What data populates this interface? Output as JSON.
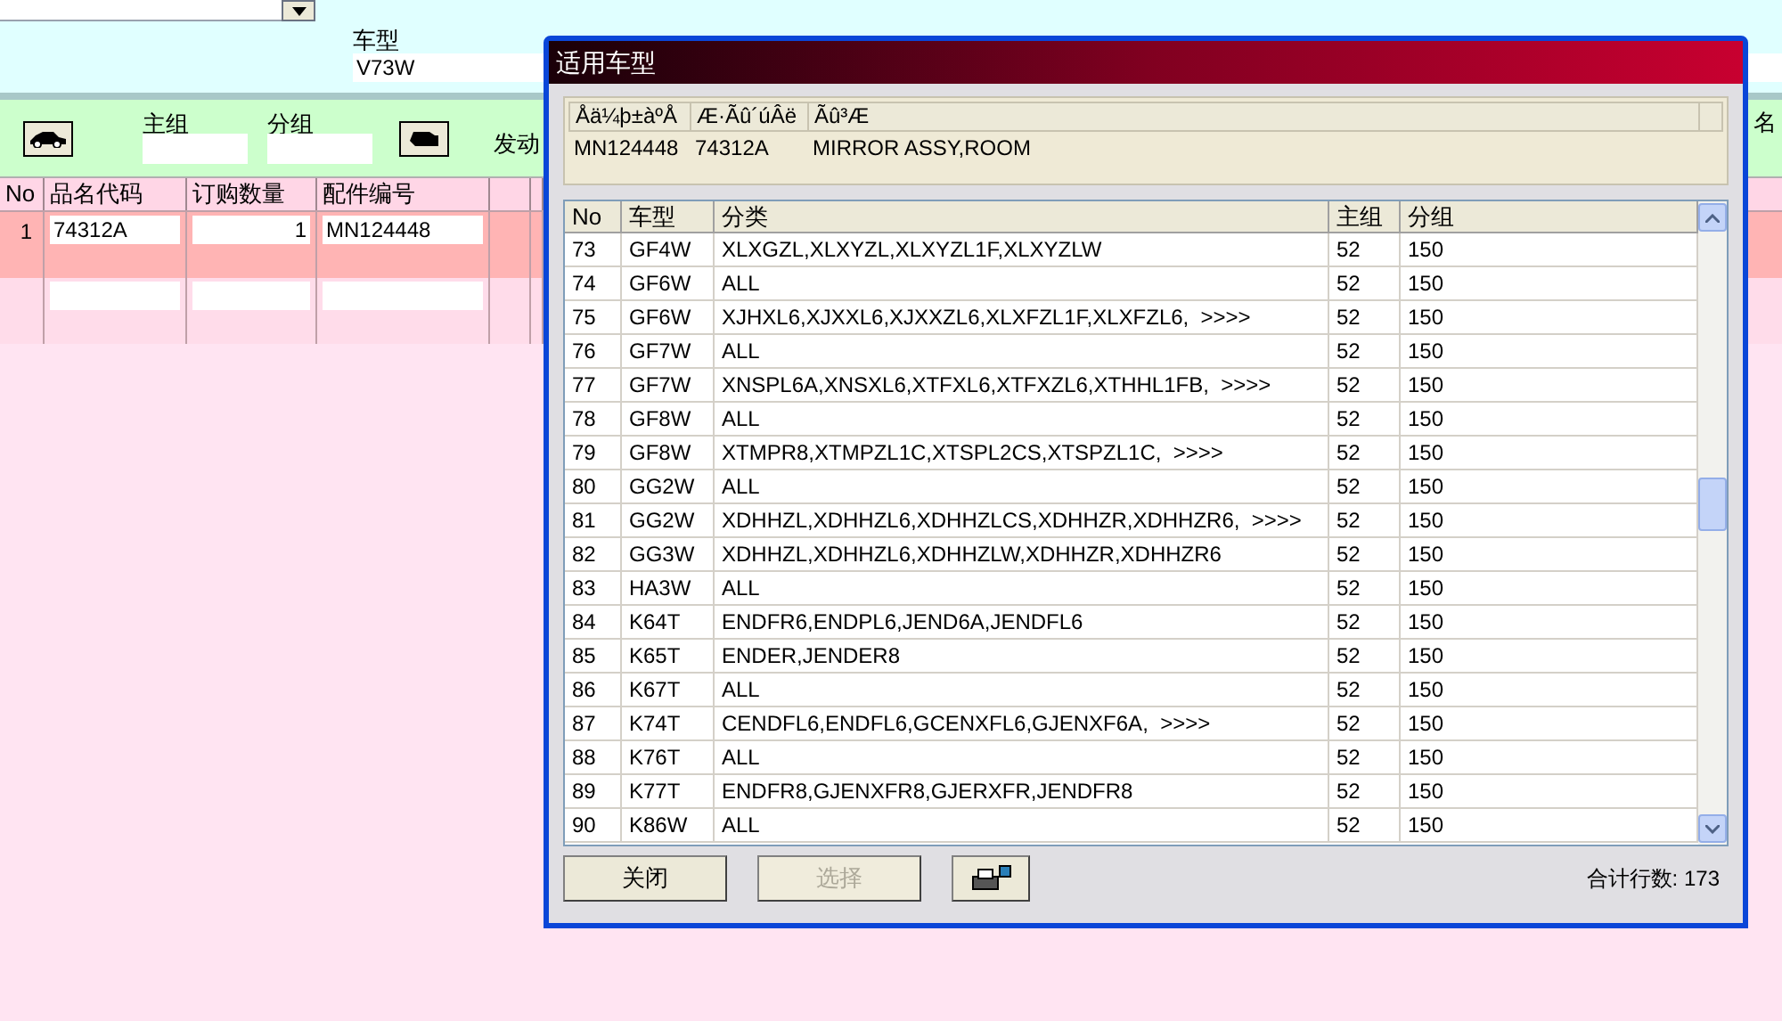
{
  "background": {
    "model_label": "车型",
    "model_value": "V73W",
    "main_group_label": "主组",
    "sub_group_label": "分组",
    "engine_label": "发动",
    "right_edge_label": "名",
    "order_columns": [
      "No",
      "品名代码",
      "订购数量",
      "配件编号"
    ],
    "order_rows": [
      {
        "no": "1",
        "code": "74312A",
        "qty": "1",
        "part": "MN124448",
        "selected": true
      },
      {
        "no": "",
        "code": "",
        "qty": "",
        "part": "",
        "selected": false
      }
    ]
  },
  "dialog": {
    "title": "适用车型",
    "info_columns": [
      "Åä¼þ±àºÅ",
      "Æ·Ãû´úÂë",
      "Ãû³Æ"
    ],
    "info_row": [
      "MN124448",
      "74312A",
      "MIRROR ASSY,ROOM"
    ],
    "columns": [
      "No",
      "车型",
      "分类",
      "主组",
      "分组"
    ],
    "rows": [
      [
        "73",
        "GF4W",
        "XLXGZL,XLXYZL,XLXYZL1F,XLXYZLW",
        "52",
        "150"
      ],
      [
        "74",
        "GF6W",
        "ALL",
        "52",
        "150"
      ],
      [
        "75",
        "GF6W",
        "XJHXL6,XJXXL6,XJXXZL6,XLXFZL1F,XLXFZL6,  >>>>",
        "52",
        "150"
      ],
      [
        "76",
        "GF7W",
        "ALL",
        "52",
        "150"
      ],
      [
        "77",
        "GF7W",
        "XNSPL6A,XNSXL6,XTFXL6,XTFXZL6,XTHHL1FB,  >>>>",
        "52",
        "150"
      ],
      [
        "78",
        "GF8W",
        "ALL",
        "52",
        "150"
      ],
      [
        "79",
        "GF8W",
        "XTMPR8,XTMPZL1C,XTSPL2CS,XTSPZL1C,  >>>>",
        "52",
        "150"
      ],
      [
        "80",
        "GG2W",
        "ALL",
        "52",
        "150"
      ],
      [
        "81",
        "GG2W",
        "XDHHZL,XDHHZL6,XDHHZLCS,XDHHZR,XDHHZR6,  >>>>",
        "52",
        "150"
      ],
      [
        "82",
        "GG3W",
        "XDHHZL,XDHHZL6,XDHHZLW,XDHHZR,XDHHZR6",
        "52",
        "150"
      ],
      [
        "83",
        "HA3W",
        "ALL",
        "52",
        "150"
      ],
      [
        "84",
        "K64T",
        "ENDFR6,ENDPL6,JEND6A,JENDFL6",
        "52",
        "150"
      ],
      [
        "85",
        "K65T",
        "ENDER,JENDER8",
        "52",
        "150"
      ],
      [
        "86",
        "K67T",
        "ALL",
        "52",
        "150"
      ],
      [
        "87",
        "K74T",
        "CENDFL6,ENDFL6,GCENXFL6,GJENXF6A,  >>>>",
        "52",
        "150"
      ],
      [
        "88",
        "K76T",
        "ALL",
        "52",
        "150"
      ],
      [
        "89",
        "K77T",
        "ENDFR8,GJENXFR8,GJERXFR,JENDFR8",
        "52",
        "150"
      ],
      [
        "90",
        "K86W",
        "ALL",
        "52",
        "150"
      ]
    ],
    "buttons": [
      {
        "label": "关闭",
        "disabled": false
      },
      {
        "label": "选择",
        "disabled": true
      }
    ],
    "total": "合计行数: 173"
  }
}
